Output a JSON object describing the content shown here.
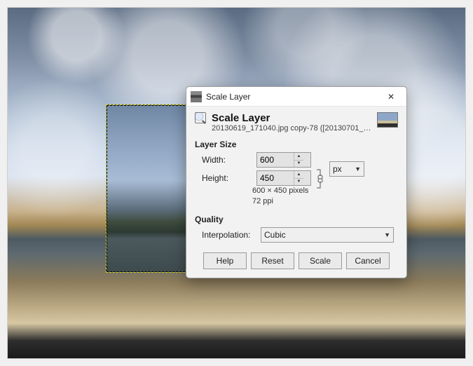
{
  "titlebar": {
    "title": "Scale Layer"
  },
  "header": {
    "title": "Scale Layer",
    "subtitle": "20130619_171040.jpg copy-78 ([20130701_…"
  },
  "sections": {
    "size_label": "Layer Size",
    "quality_label": "Quality"
  },
  "size": {
    "width_label": "Width:",
    "height_label": "Height:",
    "width_value": "600",
    "height_value": "450",
    "unit": "px",
    "info_dims": "600 × 450 pixels",
    "info_ppi": "72 ppi"
  },
  "quality": {
    "interp_label": "Interpolation:",
    "interp_value": "Cubic"
  },
  "buttons": {
    "help": "Help",
    "reset": "Reset",
    "scale": "Scale",
    "cancel": "Cancel"
  }
}
